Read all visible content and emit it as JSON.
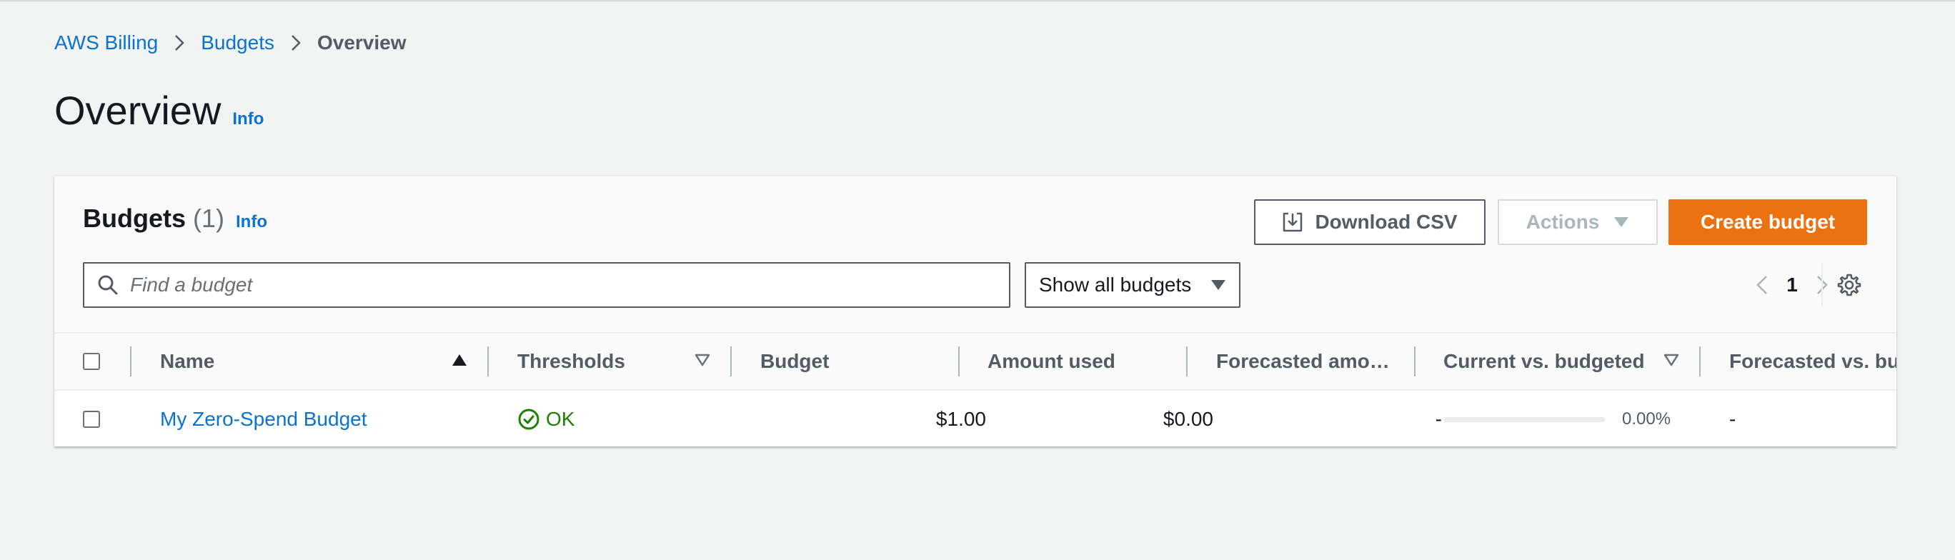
{
  "breadcrumb": {
    "items": [
      "AWS Billing",
      "Budgets"
    ],
    "current": "Overview"
  },
  "page": {
    "title": "Overview",
    "info": "Info"
  },
  "budgets_panel": {
    "title": "Budgets",
    "count": "(1)",
    "info": "Info",
    "buttons": {
      "download_csv": "Download CSV",
      "actions": "Actions",
      "create_budget": "Create budget"
    },
    "search": {
      "placeholder": "Find a budget",
      "value": ""
    },
    "filter": {
      "selected": "Show all budgets"
    },
    "pagination": {
      "current_page": "1"
    }
  },
  "table": {
    "columns": [
      "Name",
      "Thresholds",
      "Budget",
      "Amount used",
      "Forecasted amo…",
      "Current vs. budgeted",
      "Forecasted vs. bud"
    ],
    "sorted_column": "Name",
    "sort_direction": "ascending",
    "rows": [
      {
        "name": "My Zero-Spend Budget",
        "thresholds": "OK",
        "budget": "$1.00",
        "amount_used": "$0.00",
        "forecasted_amount": "-",
        "current_vs_budgeted": "0.00%",
        "current_vs_budgeted_fraction": 0.0,
        "forecasted_vs_budgeted": "-"
      }
    ]
  },
  "colors": {
    "link": "#0972d3",
    "primary_button": "#ec7211",
    "status_ok": "#1d8102",
    "background": "#f2f3f3"
  },
  "icons": {
    "breadcrumb_separator": "chevron-right-icon",
    "download": "download-icon",
    "actions_caret": "caret-down-icon",
    "search": "search-icon",
    "filter_caret": "caret-down-icon",
    "pager_prev": "chevron-left-icon",
    "pager_next": "chevron-right-icon",
    "settings": "gear-icon",
    "status_ok": "check-circle-icon"
  }
}
